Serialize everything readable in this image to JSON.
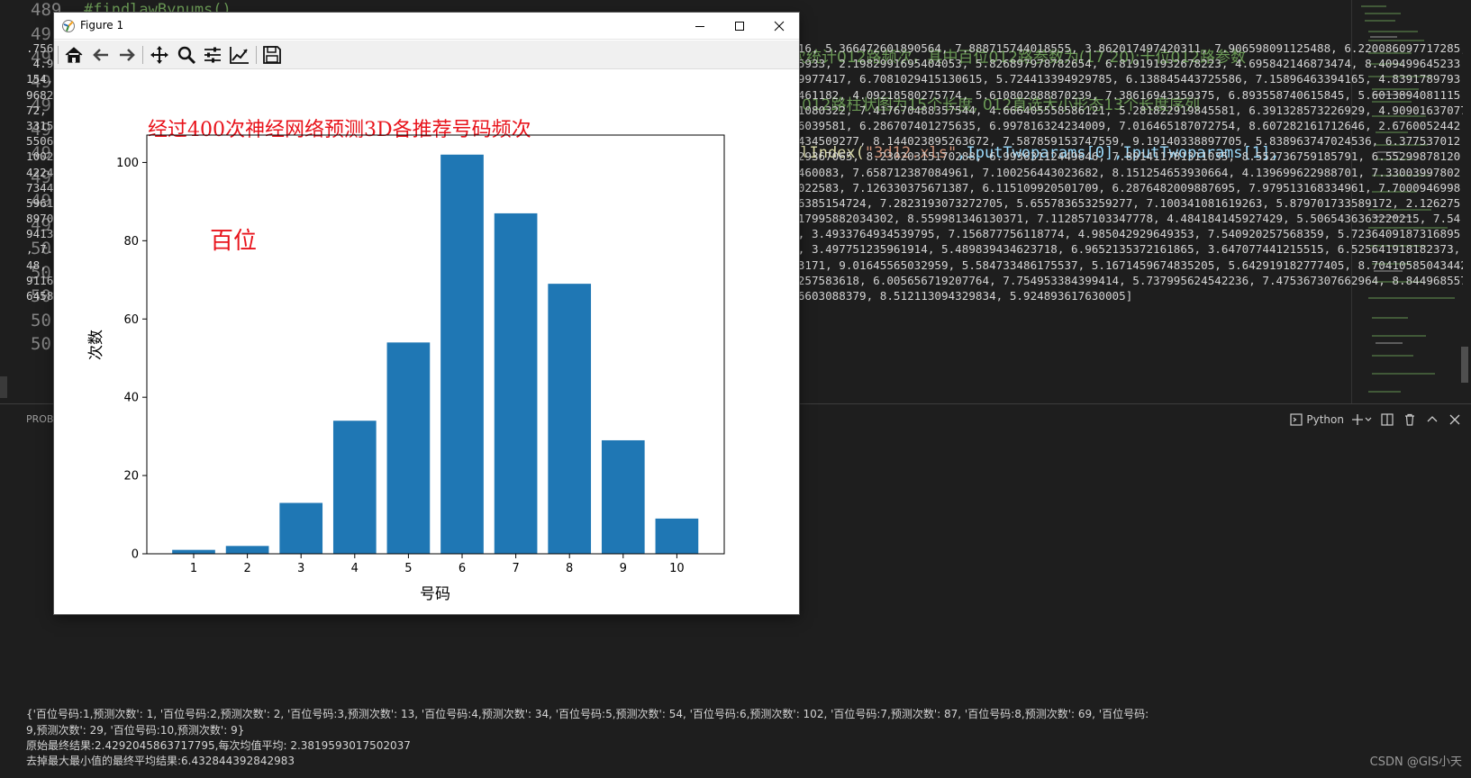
{
  "editor": {
    "lines": [
      {
        "n": "489",
        "code": "#findlawBynums()"
      },
      {
        "n": "49",
        "code": ""
      },
      {
        "n": "49",
        "code": "次统计012路频次，其中百位012路参数为(17,20);十位012路参数"
      },
      {
        "n": "49",
        "code": ""
      },
      {
        "n": "49",
        "code": "),012路柱状图为15个长度, 012直选大小形态13个长度序列"
      },
      {
        "n": "49",
        "code": ""
      },
      {
        "n": "49",
        "code_fn": "olIndex(",
        "code_str": "\"3d12.xls\"",
        "code_rest": ",IputTwoparams[0],IputTwoparams[1],"
      },
      {
        "n": "49",
        "code": ""
      },
      {
        "n": "49",
        "code": ""
      },
      {
        "n": "49",
        "code": ""
      },
      {
        "n": "50",
        "code": ""
      },
      {
        "n": "50",
        "code": ""
      },
      {
        "n": "50",
        "code": ""
      },
      {
        "n": "50",
        "code": ""
      },
      {
        "n": "50",
        "code": ""
      }
    ]
  },
  "panel": {
    "tab": "PROBL",
    "python_label": "Python",
    "terminal_lines": [
      ".7569                                                                                                           116, 5.366472601890564, 7.888715744018555, 3.862017497420311, 7.906598091125488, 6.220086097717285,",
      " 4.96                                                                                                           05933, 2.1982991695404053, 5.826897978782654, 6.819191932678223, 4.695842146873474, 8.409499645233",
      "154,                                                                                                            79977417, 6.7081029415130615, 5.724413394929785, 6.138845443725586, 7.15896463394165, 4.8391789793",
      "9682,                                                                                                           6461182, 4.09218580275774, 5.610802888870239, 7.38616943359375, 6.893558740615845, 5.6013894081115",
      "72, 6                                                                                                           01080322, 7.417670488357544, 4.666405558586121, 5.281822919845581, 6.391328573226929, 4.90901637077",
      "3315,                                                                                                           46039581, 6.286707401275635, 6.997816324234009, 7.016465187072754, 8.607282161712646, 2.6760052442",
      "55066                                                                                                           4434509277, 8.144023895263672, 7.587859153747559, 9.19140338897705, 5.838963747024536, 6.377537012",
      "10022                                                                                                           929367065, 8.23020315170288, 6.99363112449646, 7.891411781311035, 8.552736759185791, 6.55299878120",
      "4224,                                                                                                           8460083, 7.658712387084961, 7.100256443023682, 8.151254653930664, 4.139699622988701, 7.33003997802",
      "7344,                                                                                                           0022583, 7.126330375671387, 6.115109920501709, 6.2876482009887695, 7.979513168334961, 7.7000946998",
      "59619                                                                                                           36385154724, 7.2823193073272705, 5.655783653259277, 7.100341081619263, 5.879701733589172, 2.126275",
      "89702                                                                                                           217995882034302, 8.559981346130371, 7.112857103347778, 4.484184145927429, 5.5065436363220215, 7.54",
      "94139                                                                                                           8, 3.4933764934539795, 7.156877756118774, 4.985042929649353, 7.540920257568359, 5.7236409187316895",
      ", 7.091398477554321, 4.883369088172913, 5.927826404571533, 3.640064835548401, 6.367254972457886, 8.71138620376587, 3.497751235961914, 5.489839434623718, 6.9652135372161865, 3.647077441215515, 6.525641918182373, 4.9103650450706",
      "48, 7.3939125537872314, 6.992260217666626, 5.103534936904907, 8.8390107154846 2, 7.648968935012817, 4.193258166313171, 9.01645565032959, 5.584733486175537, 5.1671459674835205, 5.642919182777405, 8.704105850434424, 7.70314192771",
      "9116, 9.299399375915527, 7.5479936599731445, 4.05347418785 0952, 4.622294664382935, 6.436423540115 3564, 6.515604257583618, 6.005656719207764, 7.754953384399414, 5.737995624542236, 7.475367307662964, 8.844968557357788, 4.9672175",
      "64582825, 7.0121238231658936, 3.869917869567871, 4.061922542750835, 8.43283987045288, 3.4571988582611084, 8.722916603088379, 8.512113094329834, 5.924893617630005]"
    ],
    "result_lines": [
      "{'百位号码:1,预测次数': 1, '百位号码:2,预测次数': 2, '百位号码:3,预测次数': 13, '百位号码:4,预测次数': 34, '百位号码:5,预测次数': 54, '百位号码:6,预测次数': 102, '百位号码:7,预测次数': 87, '百位号码:8,预测次数': 69, '百位号码:",
      "9,预测次数': 29, '百位号码:10,预测次数': 9}",
      "原始最终结果:2.4292045863717795,每次均值平均: 2.3819593017502037",
      "去掉最大最小值的最终平均结果:6.432844392842983"
    ],
    "watermark": "CSDN @GIS小天"
  },
  "figure": {
    "window_title": "Figure 1",
    "icons": {
      "home": "home-icon",
      "back": "back-arrow-icon",
      "forward": "forward-arrow-icon",
      "pan": "pan-move-icon",
      "zoom": "zoom-magnifier-icon",
      "configure": "configure-subplots-icon",
      "edit": "edit-axis-icon",
      "save": "save-disk-icon"
    },
    "colors": {
      "bar": "#1f77b4",
      "title": "#e8131b",
      "annotation": "#e8131b"
    }
  },
  "chart_data": {
    "type": "bar",
    "title": "经过400次神经网络预测3D各推荐号码频次",
    "annotation": "百位",
    "xlabel": "号码",
    "ylabel": "次数",
    "categories": [
      "1",
      "2",
      "3",
      "4",
      "5",
      "6",
      "7",
      "8",
      "9",
      "10"
    ],
    "values": [
      1,
      2,
      13,
      34,
      54,
      102,
      87,
      69,
      29,
      9
    ],
    "ylim": [
      0,
      107
    ],
    "yticks": [
      "0",
      "20",
      "40",
      "60",
      "80",
      "100"
    ],
    "grid": false
  }
}
